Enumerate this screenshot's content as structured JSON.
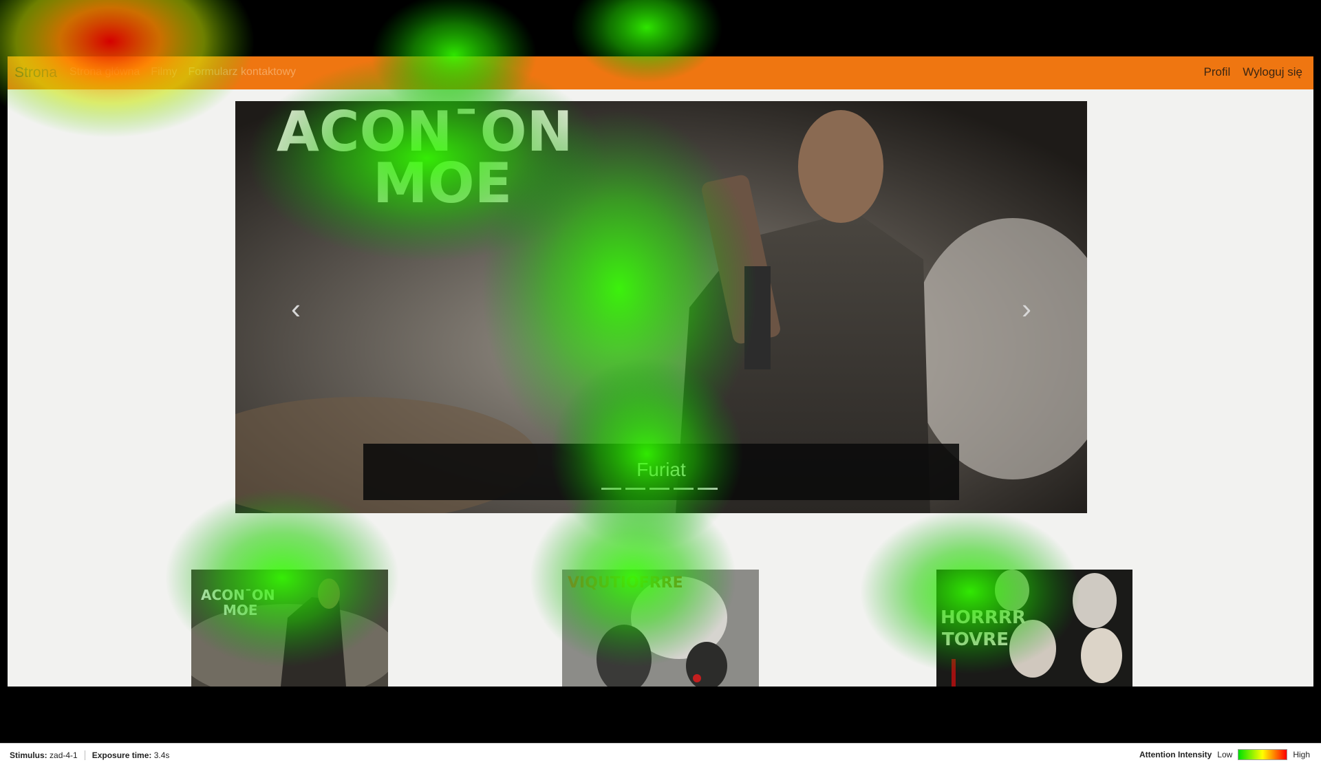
{
  "navbar": {
    "brand": "Strona",
    "links": [
      "Strona główna",
      "Filmy",
      "Formularz kontaktowy"
    ],
    "right_links": [
      "Profil",
      "Wyloguj się"
    ]
  },
  "carousel": {
    "poster_title_line1": "ACONˉON",
    "poster_title_line2": "MOE",
    "caption": "Furiat",
    "indicator_count": 5,
    "prev_icon": "chevron-left-icon",
    "next_icon": "chevron-right-icon"
  },
  "cards": [
    {
      "title_line1": "ACONˉON",
      "title_line2": "MOE"
    },
    {
      "title_line1": "VIQUTIOFRRE",
      "title_line2": ""
    },
    {
      "title_line1": "HORRRR",
      "title_line2": "TOVRE"
    }
  ],
  "footer": {
    "stimulus_label": "Stimulus:",
    "stimulus_value": "zad-4-1",
    "exposure_label": "Exposure time:",
    "exposure_value": "3.4s",
    "legend_title": "Attention Intensity",
    "legend_low": "Low",
    "legend_high": "High"
  },
  "colors": {
    "navbar": "#ef7611",
    "page_bg": "#f2f2f0",
    "heat_low": "#00e000",
    "heat_high": "#ff0000"
  }
}
